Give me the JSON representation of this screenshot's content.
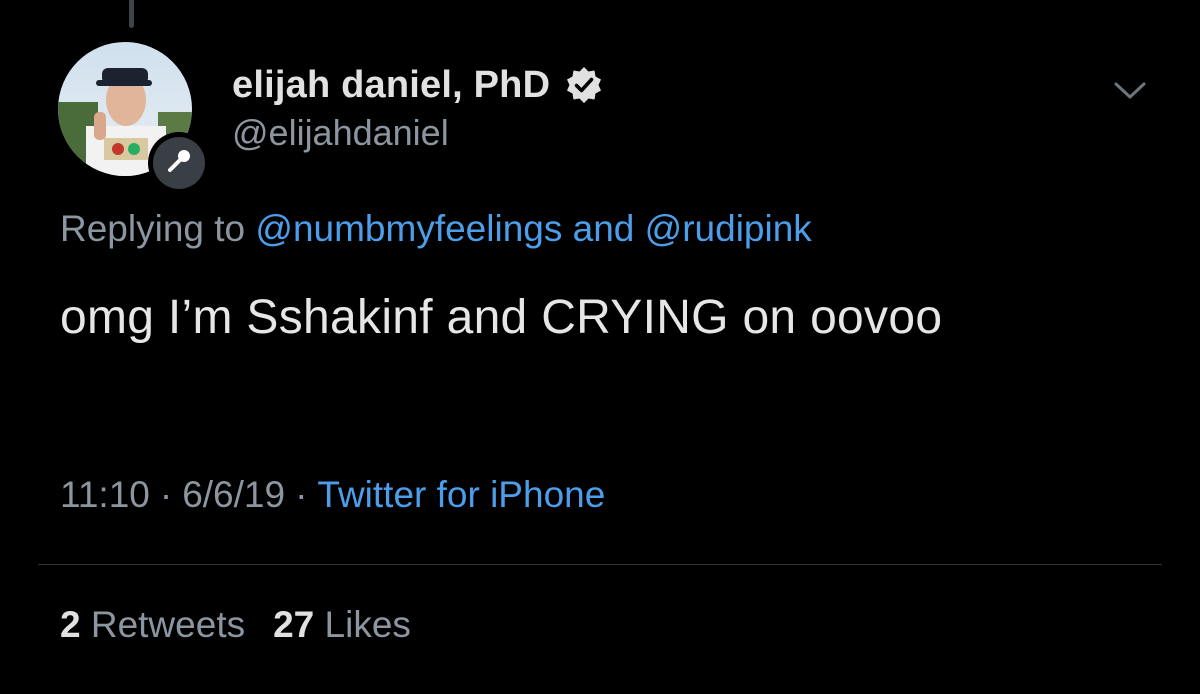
{
  "tweet": {
    "author": {
      "display_name": "elijah daniel, PhD",
      "handle": "@elijahdaniel",
      "verified_icon": "verified-badge-icon",
      "avatar_badge_icon": "microphone-icon"
    },
    "menu_icon": "chevron-down-icon",
    "reply": {
      "prefix": "Replying to",
      "mention_1": "@numbmyfeelings",
      "conjunction": "and",
      "mention_2": "@rudipink"
    },
    "text": "omg I’m Sshakinf and CRYING on oovoo",
    "meta": {
      "time": "11:10",
      "separator": "·",
      "date": "6/6/19",
      "source": "Twitter for iPhone"
    },
    "stats": {
      "retweets_count": "2",
      "retweets_label": "Retweets",
      "likes_count": "27",
      "likes_label": "Likes"
    }
  },
  "colors": {
    "background": "#000000",
    "primary_text": "#e1e1e1",
    "secondary_text": "#8b96a1",
    "link": "#4c9eeb",
    "divider": "#2f3336"
  }
}
